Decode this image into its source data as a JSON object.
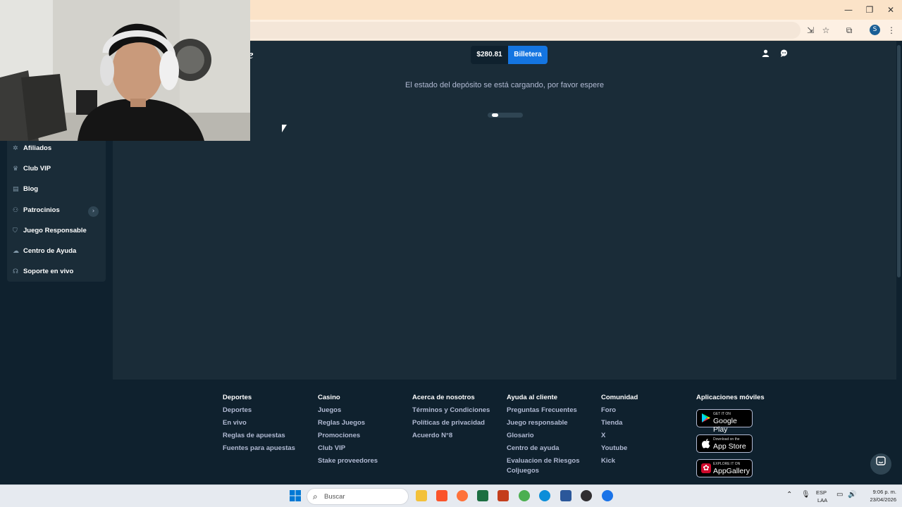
{
  "browser": {
    "icons": [
      "minimize-icon",
      "restore-icon",
      "close-icon",
      "install-app-icon",
      "bookmark-star-icon",
      "extensions-icon",
      "profile-icon",
      "menu-icon"
    ],
    "profile_initial": "S",
    "window_controls": {
      "minimize": "—",
      "restore": "❐",
      "close": "✕"
    }
  },
  "header": {
    "logo_fragment": "e",
    "balance": "$280.81",
    "wallet_label": "Billetera",
    "icons": [
      "user-icon",
      "chat-icon"
    ]
  },
  "sidebar": {
    "items": [
      {
        "label": "Afiliados",
        "icon": "affiliates-icon"
      },
      {
        "label": "Club VIP",
        "icon": "trophy-icon"
      },
      {
        "label": "Blog",
        "icon": "blog-icon"
      },
      {
        "label": "Patrocinios",
        "icon": "sponsorship-icon",
        "chevron": "›"
      },
      {
        "label": "Juego Responsable",
        "icon": "shield-icon"
      },
      {
        "label": "Centro de Ayuda",
        "icon": "help-center-icon"
      },
      {
        "label": "Soporte en vivo",
        "icon": "headset-icon"
      }
    ]
  },
  "main": {
    "loading_message": "El estado del depósito se está cargando, por favor espere"
  },
  "footer": {
    "columns": [
      {
        "title": "Deportes",
        "links": [
          "Deportes",
          "En vivo",
          "Reglas de apuestas",
          "Fuentes para apuestas"
        ]
      },
      {
        "title": "Casino",
        "links": [
          "Juegos",
          "Reglas Juegos",
          "Promociones",
          "Club VIP",
          "Stake proveedores"
        ]
      },
      {
        "title": "Acerca de nosotros",
        "links": [
          "Términos y Condiciones",
          "Políticas de privacidad",
          "Acuerdo N°8"
        ]
      },
      {
        "title": "Ayuda al cliente",
        "links": [
          "Preguntas Frecuentes",
          "Juego responsable",
          "Glosario",
          "Centro de ayuda",
          "Evaluacion de Riesgos",
          "Coljuegos"
        ]
      },
      {
        "title": "Comunidad",
        "links": [
          "Foro",
          "Tienda",
          "X",
          "Youtube",
          "Kick"
        ]
      }
    ],
    "apps": {
      "title": "Aplicaciones móviles",
      "badges": [
        {
          "small": "GET IT ON",
          "big": "Google Play",
          "icon": "google-play-icon"
        },
        {
          "small": "Download on the",
          "big": "App Store",
          "icon": "apple-icon"
        },
        {
          "small": "EXPLORE IT ON",
          "big": "AppGallery",
          "icon": "huawei-icon"
        }
      ]
    }
  },
  "taskbar": {
    "search_placeholder": "Buscar",
    "language_top": "ESP",
    "language_bottom": "LAA",
    "time": "9:06 p. m.",
    "date": "23/04/2026",
    "apps": [
      "windows-start-icon",
      "file-explorer-icon",
      "brave-icon",
      "firefox-icon",
      "excel-icon",
      "powerpoint-icon",
      "chrome-icon",
      "edge-icon",
      "word-icon",
      "obs-icon",
      "chrome-active-icon"
    ],
    "app_colors": [
      "#0078d4",
      "#f3c13a",
      "#fb542b",
      "#ff7139",
      "#1d6f42",
      "#c43e1c",
      "#4caf50",
      "#0c8ed9",
      "#2b579a",
      "#302e31",
      "#1a73e8"
    ]
  },
  "colors": {
    "accent": "#1475e1",
    "background": "#0f212e",
    "panel": "#1a2c38",
    "muted_text": "#b1bad3"
  }
}
